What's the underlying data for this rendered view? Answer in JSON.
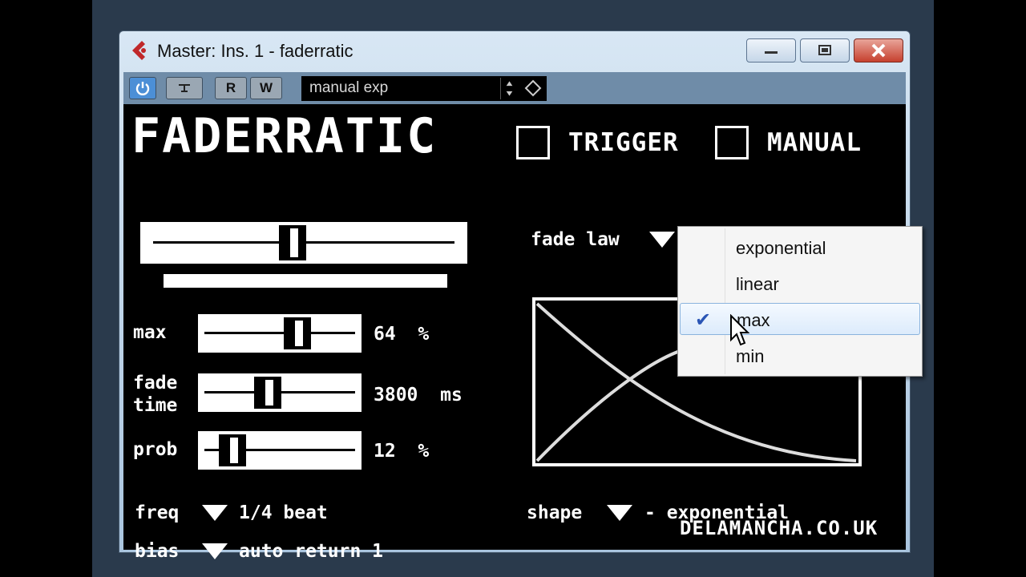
{
  "window": {
    "title": "Master: Ins. 1 - faderratic",
    "controls": {
      "minimize": "minimize-icon",
      "maximize": "maximize-icon",
      "close": "close-icon"
    }
  },
  "toolbar": {
    "read_label": "R",
    "write_label": "W",
    "preset": "manual exp"
  },
  "plugin": {
    "brand": "FADERRATIC",
    "trigger_label": "TRIGGER",
    "manual_label": "MANUAL",
    "fade_law_label": "fade law",
    "fade_law_value": "max",
    "sliders": {
      "main_level": 0.46,
      "max": {
        "label": "max",
        "value": "64",
        "unit": "%",
        "level": 0.64
      },
      "fade_time": {
        "label_line1": "fade",
        "label_line2": "time",
        "value": "3800",
        "unit": "ms",
        "level": 0.4
      },
      "prob": {
        "label": "prob",
        "value": "12",
        "unit": "%",
        "level": 0.12
      }
    },
    "freq_label": "freq",
    "freq_value": "1/4 beat",
    "bias_label": "bias",
    "bias_value": "auto return 1",
    "shape_label": "shape",
    "shape_value": "- exponential",
    "website": "DELAMANCHA.CO.UK"
  },
  "fade_law_menu": {
    "options": [
      "exponential",
      "linear",
      "max",
      "min"
    ],
    "selected": "max"
  },
  "colors": {
    "accent": "#4c8fd6",
    "toolbar": "#6f8ca8",
    "close": "#c6402e"
  }
}
